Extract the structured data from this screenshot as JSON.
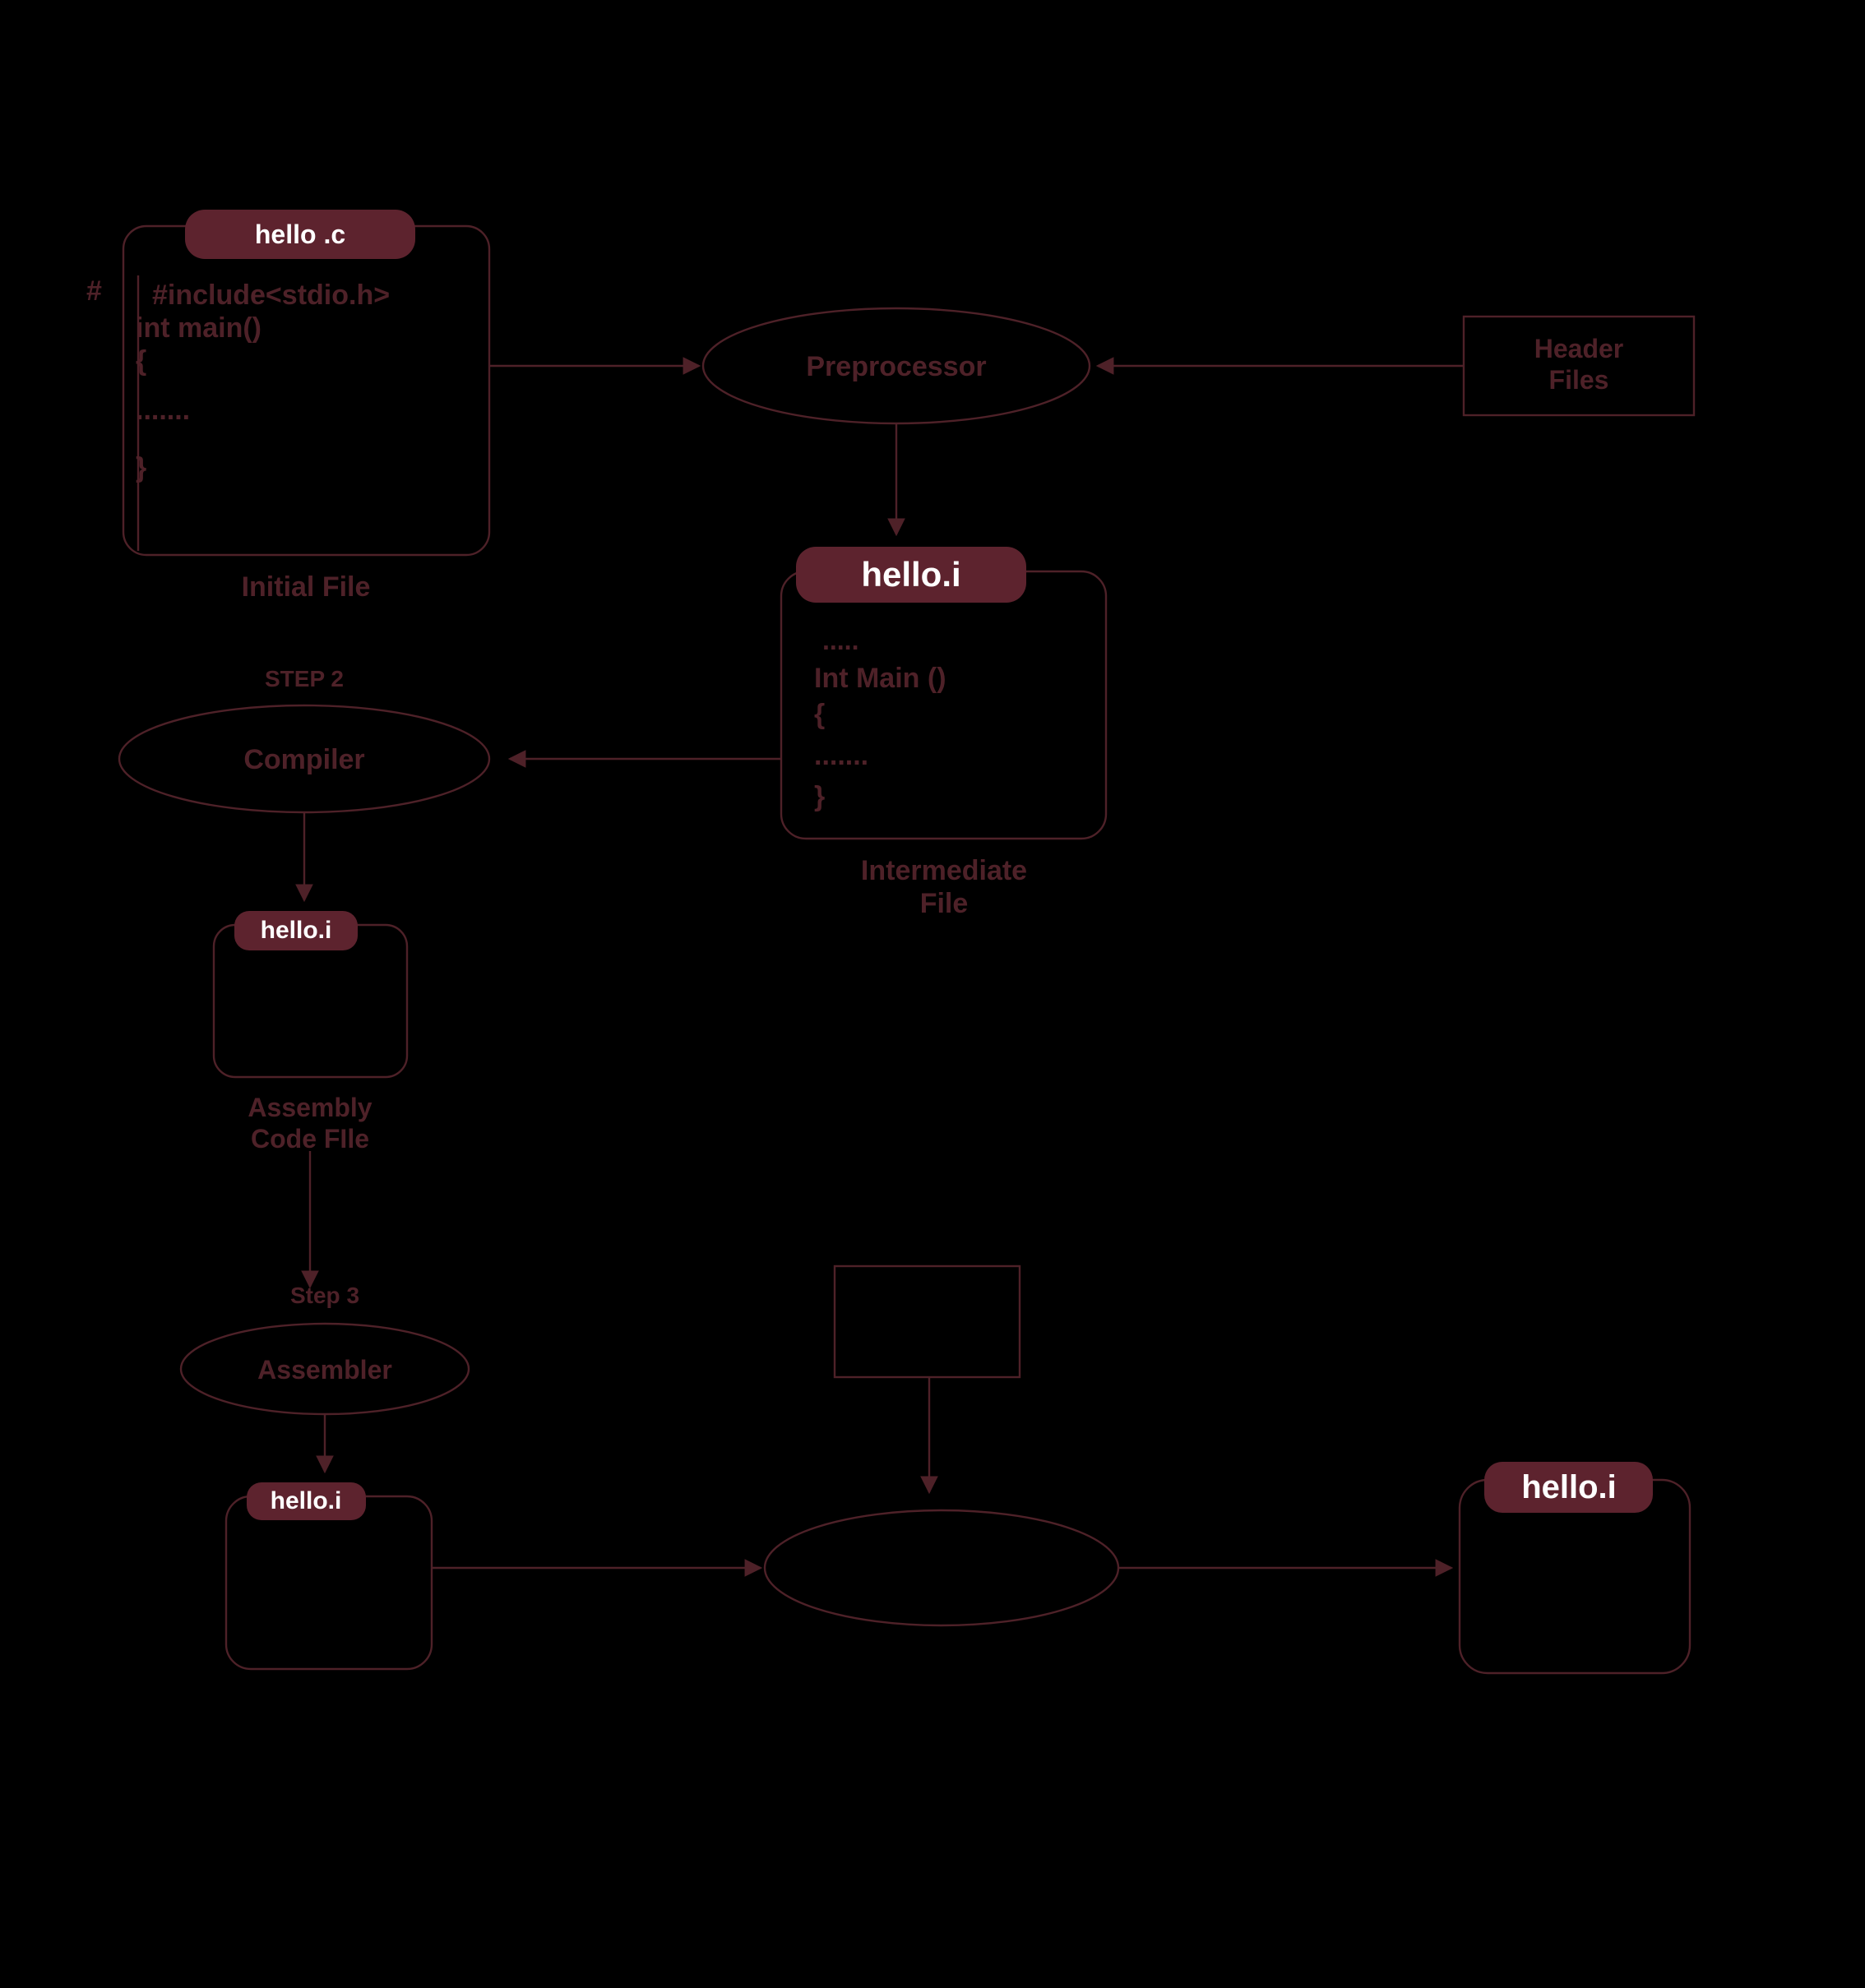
{
  "hash": "#",
  "initial": {
    "chip": "hello .c",
    "line1": "#include<stdio.h>",
    "line2": "int main()",
    "line3": "{",
    "line4": ".......",
    "line5": "}",
    "caption": "Initial File"
  },
  "preprocessor": {
    "label": "Preprocessor"
  },
  "header": {
    "line1": "Header",
    "line2": "Files"
  },
  "intermediate": {
    "chip": "hello.i",
    "line1": ".....",
    "line2": "Int Main ()",
    "line3": "{",
    "line4": ".......",
    "line5": "}",
    "caption1": "Intermediate",
    "caption2": "File"
  },
  "compiler": {
    "step": "STEP 2",
    "label": "Compiler"
  },
  "assembly": {
    "chip": "hello.i",
    "caption1": "Assembly",
    "caption2": "Code FIle"
  },
  "assembler": {
    "step": "Step 3",
    "label": "Assembler"
  },
  "object": {
    "chip": "hello.i"
  },
  "final": {
    "chip": "hello.i"
  }
}
